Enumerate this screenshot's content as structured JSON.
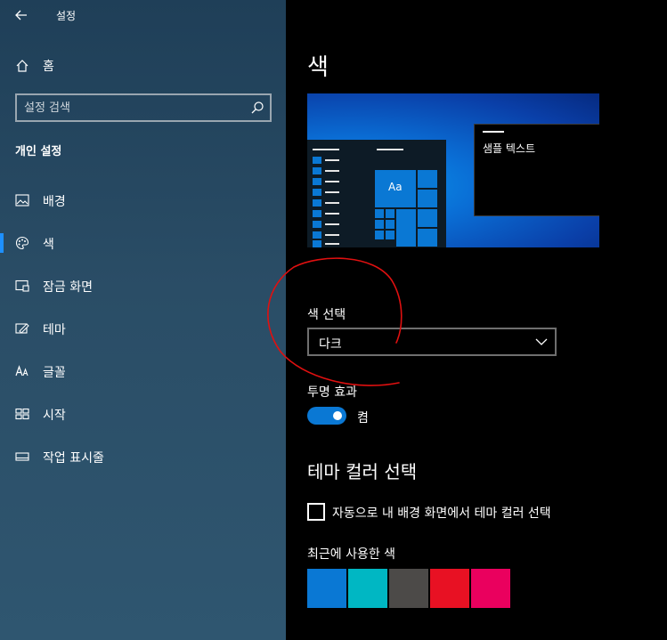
{
  "window": {
    "title": "설정"
  },
  "sidebar": {
    "home_label": "홈",
    "search_placeholder": "설정 검색",
    "section_title": "개인 설정",
    "items": [
      {
        "label": "배경",
        "icon": "image-icon"
      },
      {
        "label": "색",
        "icon": "palette-icon",
        "active": true
      },
      {
        "label": "잠금 화면",
        "icon": "lock-screen-icon"
      },
      {
        "label": "테마",
        "icon": "theme-icon"
      },
      {
        "label": "글꼴",
        "icon": "font-icon"
      },
      {
        "label": "시작",
        "icon": "start-icon"
      },
      {
        "label": "작업 표시줄",
        "icon": "taskbar-icon"
      }
    ]
  },
  "main": {
    "title": "색",
    "preview": {
      "sample_text": "샘플 텍스트",
      "tile_text": "Aa"
    },
    "color_choice": {
      "label": "색 선택",
      "value": "다크"
    },
    "transparency": {
      "label": "투명 효과",
      "state": "켬",
      "on": true
    },
    "accent": {
      "heading": "테마 컬러 선택",
      "auto_label": "자동으로 내 배경 화면에서 테마 컬러 선택",
      "auto_checked": false,
      "recent_label": "최근에 사용한 색",
      "recent_colors": [
        "#0a78d4",
        "#00b7c3",
        "#4c4a48",
        "#e81123",
        "#ea005e"
      ]
    },
    "accent_color": "#0a78d4"
  }
}
